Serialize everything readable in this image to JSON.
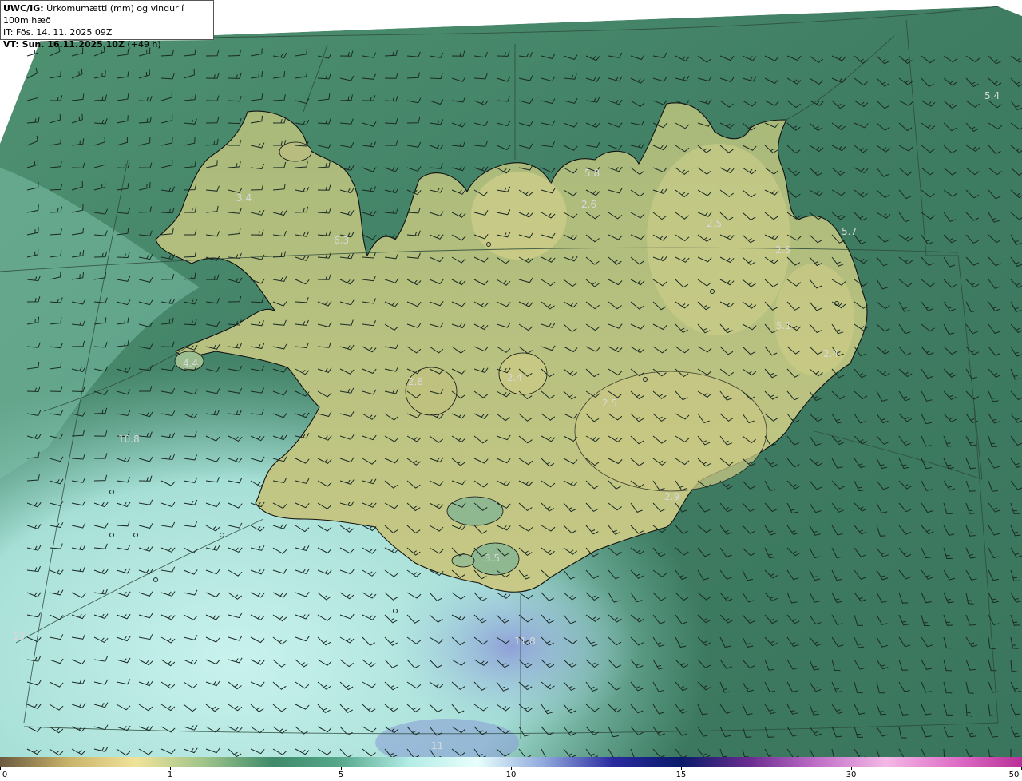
{
  "header": {
    "line1_bold": "UWC/IG:",
    "line1_rest": " Úrkomumætti (mm) og vindur í 100m hæð",
    "line2": "IT: Fös. 14. 11. 2025 09Z",
    "line3_bold": "VT: Sun. 16.11.2025 10Z",
    "line3_rest": " (+49 h)"
  },
  "colors": {
    "ocean_dark": "#3f7d63",
    "ocean_mid": "#5fa184",
    "land_low": "#8fb06e",
    "land_high": "#c7c982",
    "precip_light": "#a9e0d8",
    "precip_pale": "#c6f0ec",
    "precip_blue": "#8fa8d8",
    "coast": "#111111",
    "barb": "#1a2a24"
  },
  "colorbar": {
    "ticks": [
      "0",
      "1",
      "5",
      "10",
      "15",
      "30",
      "50"
    ],
    "stops": [
      "#6b5a3e",
      "#c9b36a",
      "#f0e39a",
      "#9fc48a",
      "#3e8a6a",
      "#57a88c",
      "#b3ece6",
      "#e8fffc",
      "#8fa7dc",
      "#2a2aa0",
      "#0a1a6a",
      "#6a2b8f",
      "#c070c8",
      "#f4b8e6",
      "#e070c8",
      "#b83098"
    ]
  },
  "labels": [
    {
      "text": "5.4"
    },
    {
      "text": "5.8"
    },
    {
      "text": "2.6"
    },
    {
      "text": "2.5"
    },
    {
      "text": "5.7"
    },
    {
      "text": "2.5"
    },
    {
      "text": "3.4"
    },
    {
      "text": "6.3"
    },
    {
      "text": "5.1"
    },
    {
      "text": "2.4"
    },
    {
      "text": "4.4"
    },
    {
      "text": "2.8"
    },
    {
      "text": "2.4"
    },
    {
      "text": "2.5"
    },
    {
      "text": "10.8"
    },
    {
      "text": "2.9"
    },
    {
      "text": "3.5"
    },
    {
      "text": "11.8"
    },
    {
      "text": "13"
    },
    {
      "text": "11"
    }
  ]
}
